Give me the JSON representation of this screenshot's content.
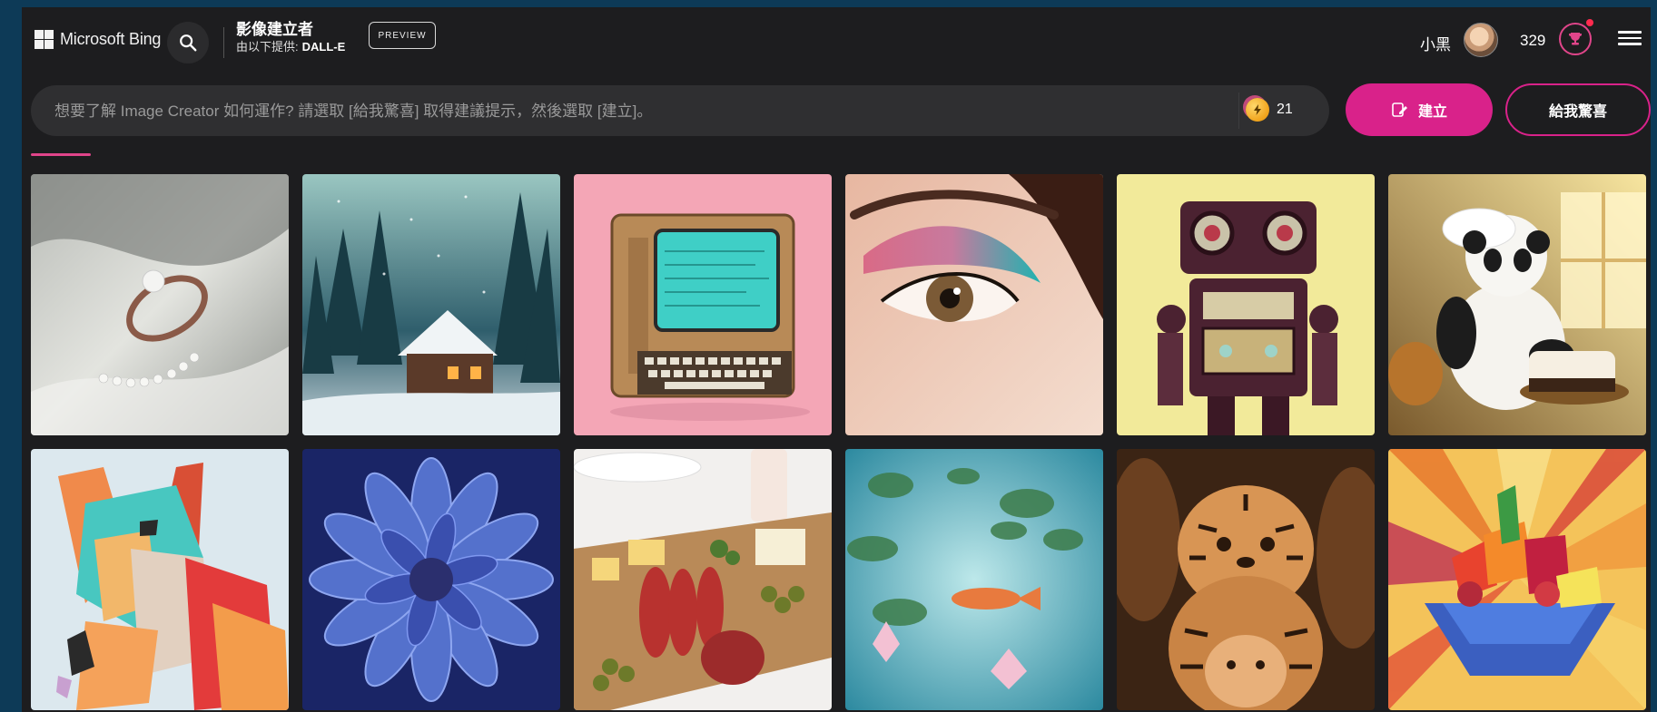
{
  "header": {
    "brand": "Microsoft Bing",
    "app_title": "影像建立者",
    "provider_prefix": "由以下提供:",
    "provider_name": "DALL-E",
    "preview_badge": "PREVIEW",
    "user_name": "小黑",
    "points": "329",
    "icons": [
      "microsoft-logo-icon",
      "search-icon",
      "avatar",
      "rewards-trophy-icon",
      "hamburger-menu-icon"
    ]
  },
  "prompt": {
    "placeholder": "想要了解 Image Creator 如何運作? 請選取 [給我驚喜] 取得建議提示，然後選取 [建立]。",
    "boosts": "21",
    "create_label": "建立",
    "surprise_label": "給我驚喜"
  },
  "colors": {
    "accent": "#d9228a",
    "page_background": "#1d1d1f",
    "outer_background": "#0d3a57"
  },
  "gallery": {
    "images": [
      "pearl-ring-on-silk",
      "snowy-cabin-in-forest",
      "retro-computer-on-pink",
      "eye-with-colorful-makeup",
      "retro-robot-illustration",
      "panda-chef-baking-cake",
      "papercraft-fox",
      "blue-chrysanthemum",
      "charcuterie-board",
      "koi-pond-watercolor",
      "tiger-figurines",
      "geometric-fruit-bowl"
    ]
  }
}
